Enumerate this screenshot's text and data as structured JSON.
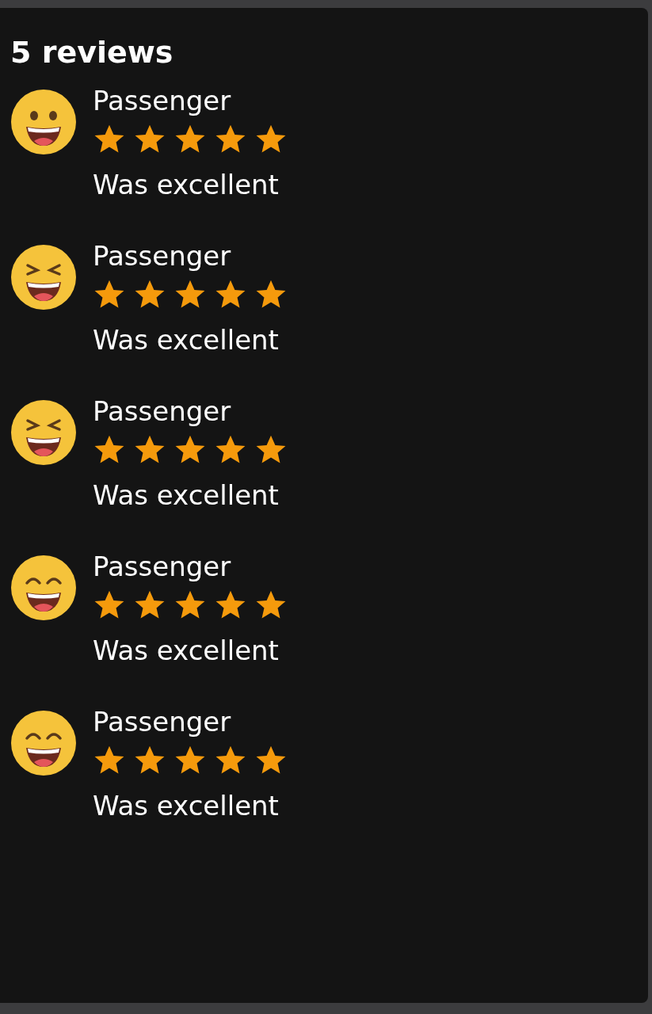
{
  "title": "5 reviews",
  "reviews": [
    {
      "kind": "grin",
      "name": "Passenger",
      "stars": 5,
      "comment": "Was excellent"
    },
    {
      "kind": "squint",
      "name": "Passenger",
      "stars": 5,
      "comment": "Was excellent"
    },
    {
      "kind": "squint",
      "name": "Passenger",
      "stars": 5,
      "comment": "Was excellent"
    },
    {
      "kind": "smile",
      "name": "Passenger",
      "stars": 5,
      "comment": "Was excellent"
    },
    {
      "kind": "smile",
      "name": "Passenger",
      "stars": 5,
      "comment": "Was excellent"
    }
  ]
}
